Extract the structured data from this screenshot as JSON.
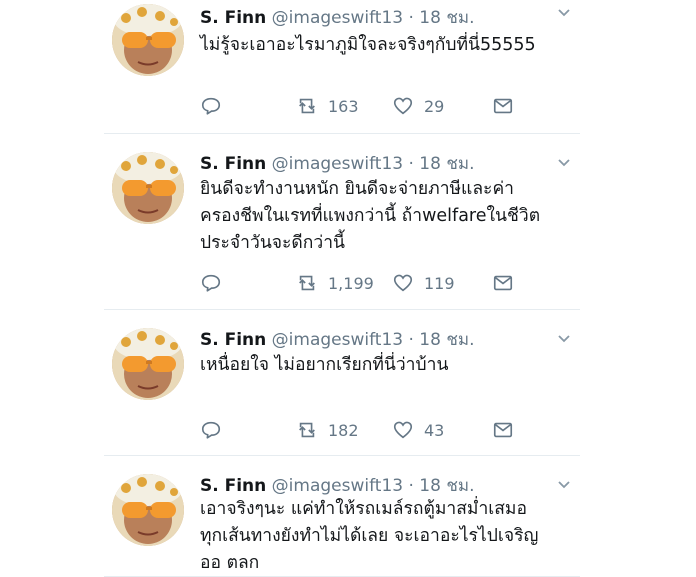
{
  "tweets": [
    {
      "name": "S. Finn",
      "handle": "@imageswift13",
      "time": "· 18 ชม.",
      "lines": [
        "ไม่รู้จะเอาอะไรมาภูมิใจละจริงๆกับที่นี่55555"
      ],
      "retweets": "163",
      "likes": "29"
    },
    {
      "name": "S. Finn",
      "handle": "@imageswift13",
      "time": "· 18 ชม.",
      "lines": [
        "ยินดีจะทำงานหนัก ยินดีจะจ่ายภาษีและค่า",
        "ครองชีพในเรทที่แพงกว่านี้ ถ้าwelfareในชีวิต",
        "ประจำวันจะดีกว่านี้"
      ],
      "retweets": "1,199",
      "likes": "119"
    },
    {
      "name": "S. Finn",
      "handle": "@imageswift13",
      "time": "· 18 ชม.",
      "lines": [
        "เหนื่อยใจ ไม่อยากเรียกที่นี่ว่าบ้าน"
      ],
      "retweets": "182",
      "likes": "43"
    },
    {
      "name": "S. Finn",
      "handle": "@imageswift13",
      "time": "· 18 ชม.",
      "lines": [
        "เอาจริงๆนะ แค่ทำให้รถเมล์รถตู้มาสม่ำเสมอ",
        "ทุกเส้นทางยังทำไม่ได้เลย จะเอาอะไรไปเจริญ",
        "ออ ตลก"
      ],
      "retweets": "",
      "likes": ""
    }
  ],
  "icons": {
    "reply": "reply-icon",
    "retweet": "retweet-icon",
    "like": "heart-icon",
    "dm": "envelope-icon",
    "menu": "chevron-down-icon"
  },
  "colors": {
    "text": "#14171a",
    "muted": "#657786",
    "divider": "#e6ecf0"
  }
}
